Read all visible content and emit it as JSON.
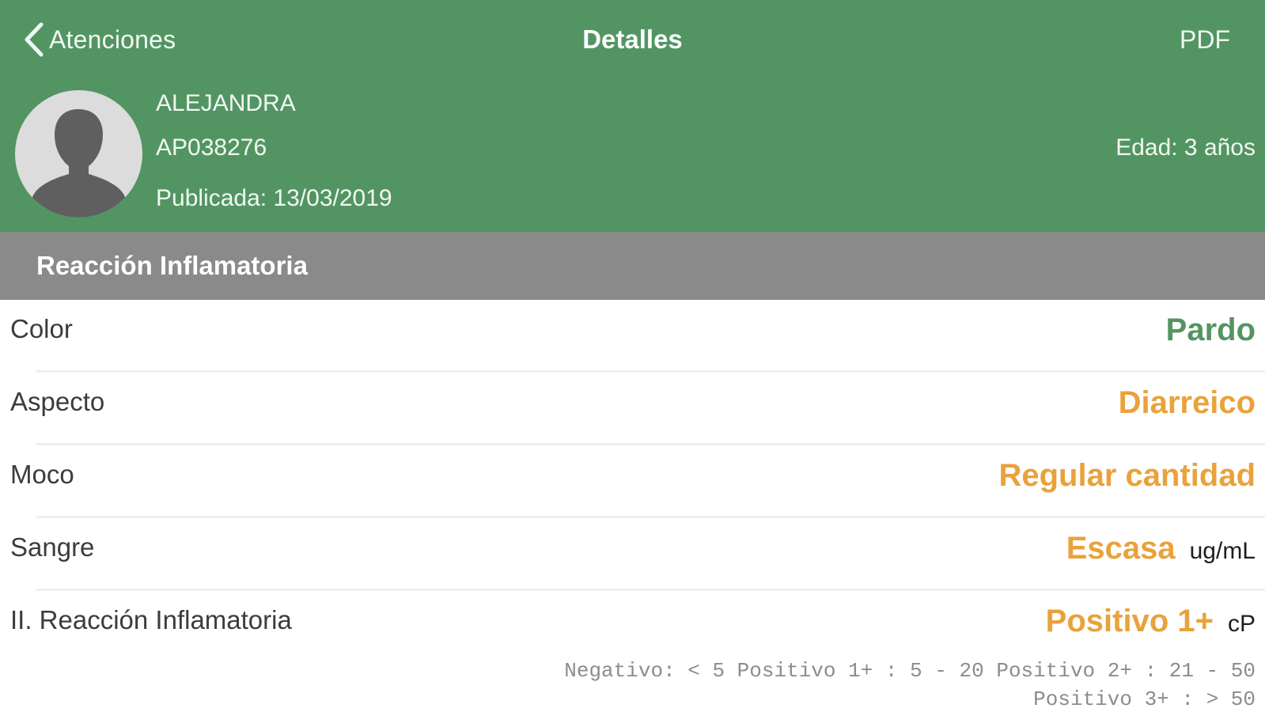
{
  "nav": {
    "back_label": "Atenciones",
    "title": "Detalles",
    "pdf_label": "PDF"
  },
  "patient": {
    "name": "ALEJANDRA",
    "id": "AP038276",
    "published": "Publicada: 13/03/2019",
    "age": "Edad: 3 años"
  },
  "section": {
    "title": "Reacción Inflamatoria"
  },
  "results": [
    {
      "label": "Color",
      "value": "Pardo",
      "unit": ""
    },
    {
      "label": "Aspecto",
      "value": "Diarreico",
      "unit": ""
    },
    {
      "label": "Moco",
      "value": "Regular cantidad",
      "unit": ""
    },
    {
      "label": "Sangre",
      "value": "Escasa",
      "unit": "ug/mL"
    },
    {
      "label": "II. Reacción Inflamatoria",
      "value": "Positivo 1+",
      "unit": "cP"
    }
  ],
  "reference": "Negativo: < 5 Positivo 1+ : 5 - 20 Positivo 2+ : 21 - 50 Positivo 3+ : > 50",
  "colors": {
    "header_bg": "#529562",
    "section_bg": "#8a8a8a",
    "value_normal": "#529562",
    "value_abnormal": "#e9a23b",
    "avatar_bg": "#dcdcdc",
    "avatar_silhouette": "#5f5f5f"
  },
  "value_status": [
    "normal",
    "abnormal",
    "abnormal",
    "abnormal",
    "abnormal"
  ],
  "icons": {
    "back": "chevron-left-icon",
    "avatar": "user-silhouette-icon"
  }
}
